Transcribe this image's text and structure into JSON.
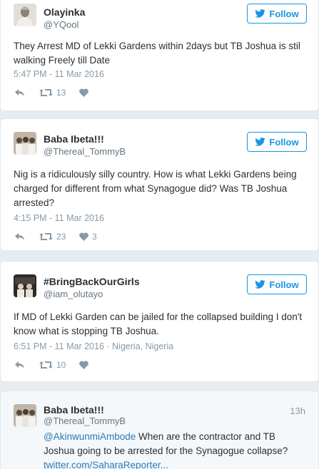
{
  "colors": {
    "background": "#e6ecf0",
    "follow_blue": "#1b95e0",
    "link_blue": "#2b7bb9",
    "muted": "#8899a6"
  },
  "tweets": [
    {
      "name": "Olayinka",
      "handle": "@YQool",
      "follow_label": "Follow",
      "text": "They Arrest MD of Lekki Gardens within 2days but TB Joshua is stil walking Freely till Date",
      "timestamp": "5:47 PM - 11 Mar 2016",
      "retweets": "13",
      "likes": ""
    },
    {
      "name": "Baba Ibeta!!!",
      "handle": "@Thereal_TommyB",
      "follow_label": "Follow",
      "text": "Nig is a ridiculously silly country. How is what Lekki Gardens being charged for different from what Synagogue did? Was TB Joshua arrested?",
      "timestamp": "4:15 PM - 11 Mar 2016",
      "retweets": "23",
      "likes": "3"
    },
    {
      "name": "#BringBackOurGirls",
      "handle": "@iam_olutayo",
      "follow_label": "Follow",
      "text": "If MD of Lekki Garden can be jailed for the collapsed building I don't know what is stopping TB Joshua.",
      "timestamp": "6:51 PM - 11 Mar 2016",
      "location": " · Nigeria, Nigeria",
      "retweets": "10",
      "likes": ""
    },
    {
      "name": "Baba Ibeta!!!",
      "handle": "@Thereal_TommyB",
      "time_ago": "13h",
      "mention": "@AkinwunmiAmbode",
      "text": " When are the contractor and TB Joshua going to be arrested for the Synagogue collapse?",
      "link": "twitter.com/SaharaReporter..."
    }
  ]
}
